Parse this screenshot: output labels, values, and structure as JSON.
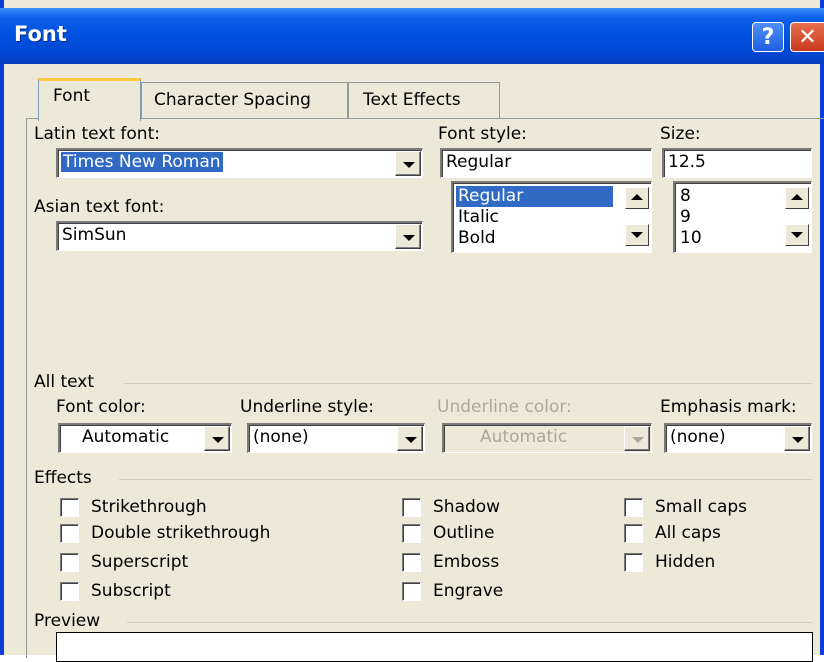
{
  "window": {
    "title": "Font",
    "help_label": "?",
    "close_label": "✕"
  },
  "tabs": {
    "font": "Font",
    "character_spacing": "Character Spacing",
    "text_effects": "Text Effects"
  },
  "latin_font": {
    "label": "Latin text font:",
    "value": "Times New Roman"
  },
  "asian_font": {
    "label": "Asian text font:",
    "value": "SimSun"
  },
  "font_style": {
    "label": "Font style:",
    "value": "Regular",
    "options": [
      "Regular",
      "Italic",
      "Bold"
    ]
  },
  "size": {
    "label": "Size:",
    "value": "12.5",
    "options": [
      "8",
      "9",
      "10"
    ]
  },
  "all_text": {
    "heading": "All text",
    "font_color_label": "Font color:",
    "font_color_value": "Automatic",
    "underline_style_label": "Underline style:",
    "underline_style_value": "(none)",
    "underline_color_label": "Underline color:",
    "underline_color_value": "Automatic",
    "emphasis_mark_label": "Emphasis mark:",
    "emphasis_mark_value": "(none)"
  },
  "effects": {
    "heading": "Effects",
    "strikethrough": "Strikethrough",
    "double_strikethrough": "Double strikethrough",
    "superscript": "Superscript",
    "subscript": "Subscript",
    "shadow": "Shadow",
    "outline": "Outline",
    "emboss": "Emboss",
    "engrave": "Engrave",
    "small_caps": "Small caps",
    "all_caps": "All caps",
    "hidden": "Hidden"
  },
  "preview": {
    "heading": "Preview"
  }
}
